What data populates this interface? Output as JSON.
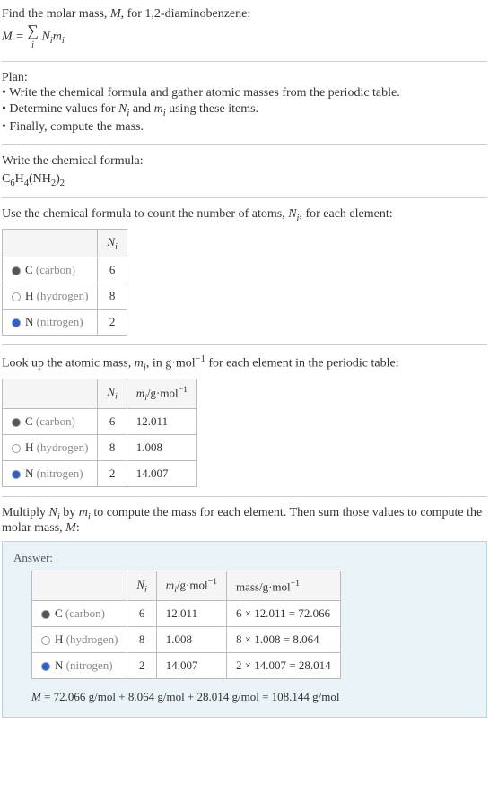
{
  "intro": {
    "line1_pre": "Find the molar mass, ",
    "line1_M": "M",
    "line1_post": ", for 1,2-diaminobenzene:",
    "eq_left": "M = ",
    "sum_i": "i",
    "eq_right_N": "N",
    "eq_right_m": "m",
    "eq_right_i": "i"
  },
  "plan": {
    "heading": "Plan:",
    "b1": "• Write the chemical formula and gather atomic masses from the periodic table.",
    "b2_pre": "• Determine values for ",
    "b2_N": "N",
    "b2_i": "i",
    "b2_mid": " and ",
    "b2_m": "m",
    "b2_post": " using these items.",
    "b3": "• Finally, compute the mass."
  },
  "chem": {
    "heading": "Write the chemical formula:",
    "formula_C": "C",
    "formula_6": "6",
    "formula_H": "H",
    "formula_4": "4",
    "formula_NH": "(NH",
    "formula_2a": "2",
    "formula_close": ")",
    "formula_2b": "2"
  },
  "count": {
    "text_pre": "Use the chemical formula to count the number of atoms, ",
    "text_N": "N",
    "text_i": "i",
    "text_post": ", for each element:",
    "header_N": "N",
    "header_i": "i",
    "rows": [
      {
        "sym": "C",
        "name": "(carbon)",
        "n": "6",
        "sw": "c"
      },
      {
        "sym": "H",
        "name": "(hydrogen)",
        "n": "8",
        "sw": "h"
      },
      {
        "sym": "N",
        "name": "(nitrogen)",
        "n": "2",
        "sw": "n"
      }
    ]
  },
  "lookup": {
    "text_pre": "Look up the atomic mass, ",
    "text_m": "m",
    "text_i": "i",
    "text_mid": ", in g·mol",
    "text_exp": "−1",
    "text_post": " for each element in the periodic table:",
    "hN": "N",
    "hNi": "i",
    "hm": "m",
    "hmi": "i",
    "hunit": "/g·mol",
    "hexp": "−1",
    "rows": [
      {
        "sym": "C",
        "name": "(carbon)",
        "n": "6",
        "m": "12.011",
        "sw": "c"
      },
      {
        "sym": "H",
        "name": "(hydrogen)",
        "n": "8",
        "m": "1.008",
        "sw": "h"
      },
      {
        "sym": "N",
        "name": "(nitrogen)",
        "n": "2",
        "m": "14.007",
        "sw": "n"
      }
    ]
  },
  "mult": {
    "text_pre": "Multiply ",
    "N": "N",
    "i": "i",
    "by": " by ",
    "m": "m",
    "text_mid": " to compute the mass for each element. Then sum those values to compute the molar mass, ",
    "M": "M",
    "text_post": ":"
  },
  "answer": {
    "label": "Answer:",
    "hN": "N",
    "hNi": "i",
    "hm": "m",
    "hmi": "i",
    "hunit": "/g·mol",
    "hexp": "−1",
    "hmass": "mass/g·mol",
    "rows": [
      {
        "sym": "C",
        "name": "(carbon)",
        "n": "6",
        "m": "12.011",
        "mass": "6 × 12.011 = 72.066",
        "sw": "c"
      },
      {
        "sym": "H",
        "name": "(hydrogen)",
        "n": "8",
        "m": "1.008",
        "mass": "8 × 1.008 = 8.064",
        "sw": "h"
      },
      {
        "sym": "N",
        "name": "(nitrogen)",
        "n": "2",
        "m": "14.007",
        "mass": "2 × 14.007 = 28.014",
        "sw": "n"
      }
    ],
    "final_M": "M",
    "final_eq": " = 72.066 g/mol + 8.064 g/mol + 28.014 g/mol = 108.144 g/mol"
  }
}
